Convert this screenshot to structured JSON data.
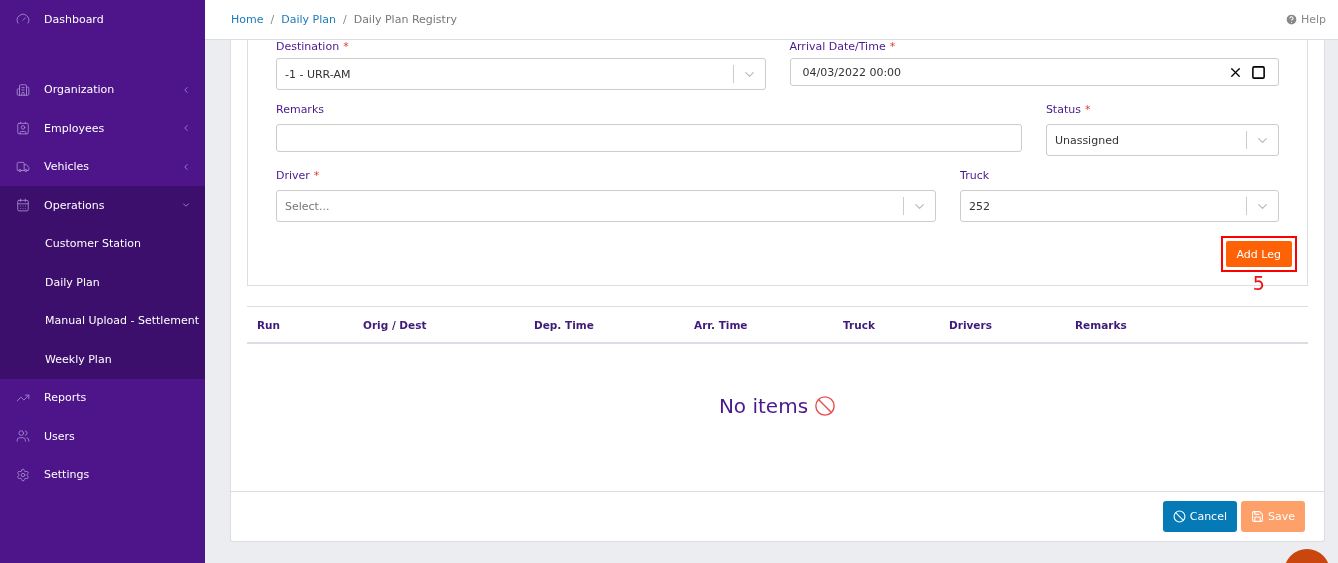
{
  "sidebar": {
    "items": [
      {
        "label": "Dashboard"
      },
      {
        "label": "Organization",
        "expanded": false
      },
      {
        "label": "Employees",
        "expanded": false
      },
      {
        "label": "Vehicles",
        "expanded": false
      },
      {
        "label": "Operations",
        "expanded": true,
        "children": [
          {
            "label": "Customer Station"
          },
          {
            "label": "Daily Plan"
          },
          {
            "label": "Manual Upload - Settlement"
          },
          {
            "label": "Weekly Plan"
          }
        ]
      },
      {
        "label": "Reports"
      },
      {
        "label": "Users"
      },
      {
        "label": "Settings"
      }
    ]
  },
  "breadcrumb": {
    "separator": "/",
    "items": [
      {
        "label": "Home",
        "link": true
      },
      {
        "label": "Daily Plan",
        "link": true
      },
      {
        "label": "Daily Plan Registry",
        "link": false
      }
    ]
  },
  "help": "Help",
  "form": {
    "required_mark": "*",
    "rows": [
      [
        {
          "label": "Destination",
          "required": true,
          "kind": "select",
          "value": "-1 - URR-AM"
        },
        {
          "label": "Arrival Date/Time",
          "required": true,
          "kind": "datetime",
          "value": "04/03/2022 00:00"
        }
      ],
      [
        {
          "label": "Remarks",
          "required": false,
          "kind": "text"
        },
        {
          "label": "Status",
          "required": true,
          "kind": "select",
          "value": "Unassigned"
        }
      ],
      [
        {
          "label": "Driver",
          "required": true,
          "kind": "select",
          "placeholder": "Select..."
        },
        {
          "label": "Truck",
          "required": false,
          "kind": "select",
          "value": "252"
        }
      ]
    ],
    "add_button": "Add Leg",
    "annotation": "5"
  },
  "table": {
    "columns": [
      "Run",
      "Orig / Dest",
      "Dep. Time",
      "Arr. Time",
      "Truck",
      "Drivers",
      "Remarks"
    ],
    "empty_text": "No items"
  },
  "footer": {
    "buttons": [
      {
        "label": "Cancel",
        "kind": "cancel",
        "disabled": false
      },
      {
        "label": "Save",
        "kind": "save",
        "disabled": true
      }
    ]
  }
}
